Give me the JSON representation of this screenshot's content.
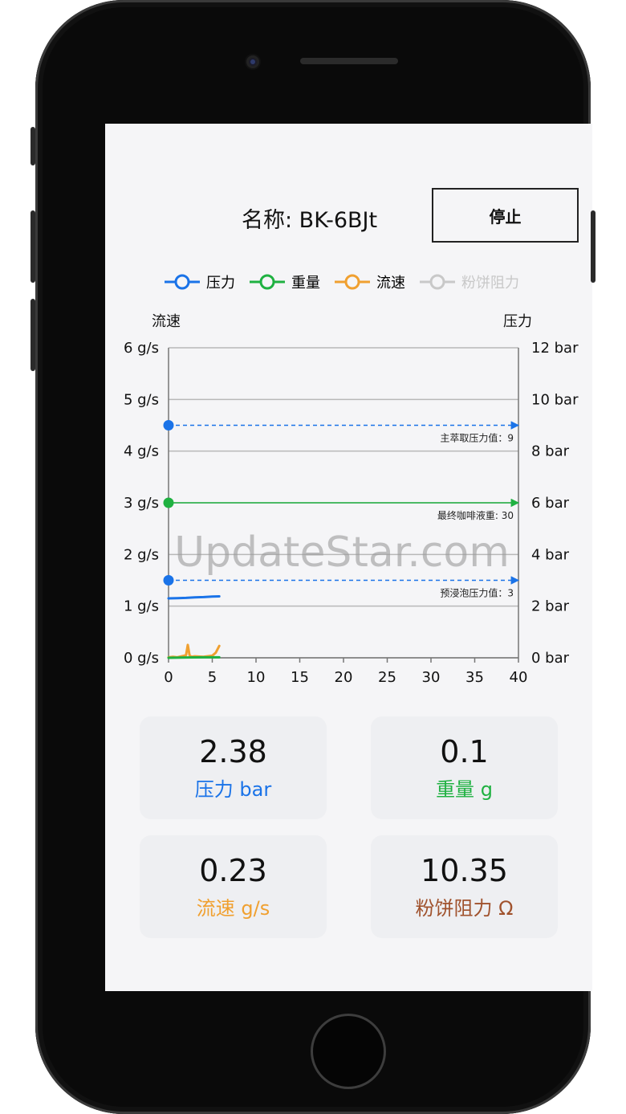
{
  "header": {
    "name_title": "名称: BK-6BJt",
    "stop_label": "停止"
  },
  "legend": [
    {
      "label": "压力",
      "color": "#1a73e8",
      "active": true
    },
    {
      "label": "重量",
      "color": "#1fb141",
      "active": true
    },
    {
      "label": "流速",
      "color": "#f0a030",
      "active": true
    },
    {
      "label": "粉饼阻力",
      "color": "#c8c8c8",
      "active": false
    }
  ],
  "chart_data": {
    "type": "line",
    "ylabel": "流速",
    "y2label": "压力",
    "xlim": [
      0,
      40
    ],
    "ylim": [
      0,
      6
    ],
    "y2lim": [
      0,
      12
    ],
    "x_ticks": [
      "0",
      "5",
      "10",
      "15",
      "20",
      "25",
      "30",
      "35",
      "40"
    ],
    "y_ticks": [
      "0 g/s",
      "1 g/s",
      "2 g/s",
      "3 g/s",
      "4 g/s",
      "5 g/s",
      "6 g/s"
    ],
    "y2_ticks": [
      "0 bar",
      "2 bar",
      "4 bar",
      "6 bar",
      "8 bar",
      "10 bar",
      "12 bar"
    ],
    "grid": true,
    "markers": [
      {
        "label": "主萃取压力值：9",
        "axis": "y2",
        "value": 9,
        "color": "#1a73e8",
        "style": "dashed"
      },
      {
        "label": "最终咖啡液重: 30",
        "axis": "y2",
        "value": 6,
        "color": "#1fb141",
        "style": "solid"
      },
      {
        "label": "预浸泡压力值：3",
        "axis": "y2",
        "value": 3,
        "color": "#1a73e8",
        "style": "dashed"
      }
    ],
    "series": [
      {
        "name": "压力",
        "axis": "y2",
        "color": "#1a73e8",
        "x": [
          0,
          1,
          2,
          3,
          4,
          5,
          5.8
        ],
        "y": [
          2.3,
          2.31,
          2.32,
          2.34,
          2.35,
          2.37,
          2.38
        ]
      },
      {
        "name": "流速",
        "axis": "y",
        "color": "#f0a030",
        "x": [
          0,
          0.5,
          1,
          1.5,
          2,
          2.2,
          2.4,
          2.6,
          3,
          4,
          5,
          5.4,
          5.8
        ],
        "y": [
          0.01,
          0.02,
          0.01,
          0.03,
          0.05,
          0.25,
          0.05,
          0.02,
          0.03,
          0.02,
          0.04,
          0.1,
          0.23
        ]
      },
      {
        "name": "重量",
        "axis": "y",
        "color": "#1fb141",
        "x": [
          0,
          2,
          4,
          5.8
        ],
        "y": [
          0,
          0.005,
          0.01,
          0.01
        ]
      }
    ]
  },
  "watermark": "UpdateStar.com",
  "stats": [
    {
      "value": "2.38",
      "label": "压力 bar",
      "color": "#1a73e8"
    },
    {
      "value": "0.1",
      "label": "重量 g",
      "color": "#1fb141"
    },
    {
      "value": "0.23",
      "label": "流速 g/s",
      "color": "#f0a030"
    },
    {
      "value": "10.35",
      "label": "粉饼阻力 Ω",
      "color": "#a0522d"
    }
  ]
}
